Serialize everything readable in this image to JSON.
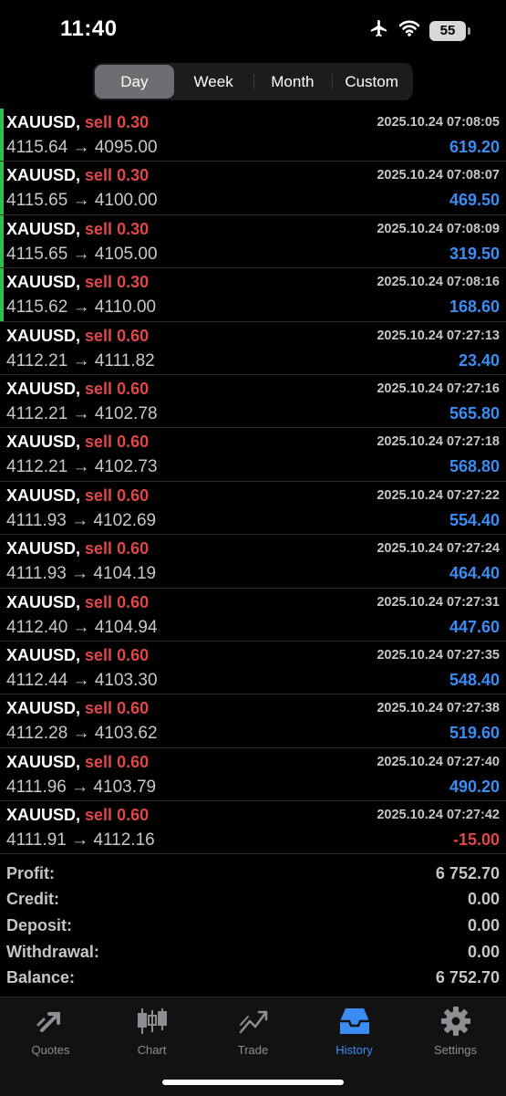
{
  "status": {
    "time": "11:40",
    "battery": "55"
  },
  "segments": [
    {
      "label": "Day",
      "active": true
    },
    {
      "label": "Week",
      "active": false
    },
    {
      "label": "Month",
      "active": false
    },
    {
      "label": "Custom",
      "active": false
    }
  ],
  "deals": [
    {
      "symbol": "XAUUSD",
      "side": "sell",
      "volume": "0.30",
      "open": "4115.64",
      "close": "4095.00",
      "time": "2025.10.24 07:08:05",
      "profit": "619.20",
      "marked": true
    },
    {
      "symbol": "XAUUSD",
      "side": "sell",
      "volume": "0.30",
      "open": "4115.65",
      "close": "4100.00",
      "time": "2025.10.24 07:08:07",
      "profit": "469.50",
      "marked": true
    },
    {
      "symbol": "XAUUSD",
      "side": "sell",
      "volume": "0.30",
      "open": "4115.65",
      "close": "4105.00",
      "time": "2025.10.24 07:08:09",
      "profit": "319.50",
      "marked": true
    },
    {
      "symbol": "XAUUSD",
      "side": "sell",
      "volume": "0.30",
      "open": "4115.62",
      "close": "4110.00",
      "time": "2025.10.24 07:08:16",
      "profit": "168.60",
      "marked": true
    },
    {
      "symbol": "XAUUSD",
      "side": "sell",
      "volume": "0.60",
      "open": "4112.21",
      "close": "4111.82",
      "time": "2025.10.24 07:27:13",
      "profit": "23.40",
      "marked": false
    },
    {
      "symbol": "XAUUSD",
      "side": "sell",
      "volume": "0.60",
      "open": "4112.21",
      "close": "4102.78",
      "time": "2025.10.24 07:27:16",
      "profit": "565.80",
      "marked": false
    },
    {
      "symbol": "XAUUSD",
      "side": "sell",
      "volume": "0.60",
      "open": "4112.21",
      "close": "4102.73",
      "time": "2025.10.24 07:27:18",
      "profit": "568.80",
      "marked": false
    },
    {
      "symbol": "XAUUSD",
      "side": "sell",
      "volume": "0.60",
      "open": "4111.93",
      "close": "4102.69",
      "time": "2025.10.24 07:27:22",
      "profit": "554.40",
      "marked": false
    },
    {
      "symbol": "XAUUSD",
      "side": "sell",
      "volume": "0.60",
      "open": "4111.93",
      "close": "4104.19",
      "time": "2025.10.24 07:27:24",
      "profit": "464.40",
      "marked": false
    },
    {
      "symbol": "XAUUSD",
      "side": "sell",
      "volume": "0.60",
      "open": "4112.40",
      "close": "4104.94",
      "time": "2025.10.24 07:27:31",
      "profit": "447.60",
      "marked": false
    },
    {
      "symbol": "XAUUSD",
      "side": "sell",
      "volume": "0.60",
      "open": "4112.44",
      "close": "4103.30",
      "time": "2025.10.24 07:27:35",
      "profit": "548.40",
      "marked": false
    },
    {
      "symbol": "XAUUSD",
      "side": "sell",
      "volume": "0.60",
      "open": "4112.28",
      "close": "4103.62",
      "time": "2025.10.24 07:27:38",
      "profit": "519.60",
      "marked": false
    },
    {
      "symbol": "XAUUSD",
      "side": "sell",
      "volume": "0.60",
      "open": "4111.96",
      "close": "4103.79",
      "time": "2025.10.24 07:27:40",
      "profit": "490.20",
      "marked": false
    },
    {
      "symbol": "XAUUSD",
      "side": "sell",
      "volume": "0.60",
      "open": "4111.91",
      "close": "4112.16",
      "time": "2025.10.24 07:27:42",
      "profit": "-15.00",
      "marked": false
    }
  ],
  "summary": [
    {
      "label": "Profit:",
      "value": "6 752.70"
    },
    {
      "label": "Credit:",
      "value": "0.00"
    },
    {
      "label": "Deposit:",
      "value": "0.00"
    },
    {
      "label": "Withdrawal:",
      "value": "0.00"
    },
    {
      "label": "Balance:",
      "value": "6 752.70"
    }
  ],
  "tabs": [
    {
      "label": "Quotes",
      "icon": "quotes-icon",
      "active": false
    },
    {
      "label": "Chart",
      "icon": "chart-icon",
      "active": false
    },
    {
      "label": "Trade",
      "icon": "trade-icon",
      "active": false
    },
    {
      "label": "History",
      "icon": "history-icon",
      "active": true
    },
    {
      "label": "Settings",
      "icon": "gear-icon",
      "active": false
    }
  ],
  "colors": {
    "accent": "#3b8cf5",
    "sell": "#e04646",
    "marker": "#2ec14a",
    "background": "#000000"
  }
}
